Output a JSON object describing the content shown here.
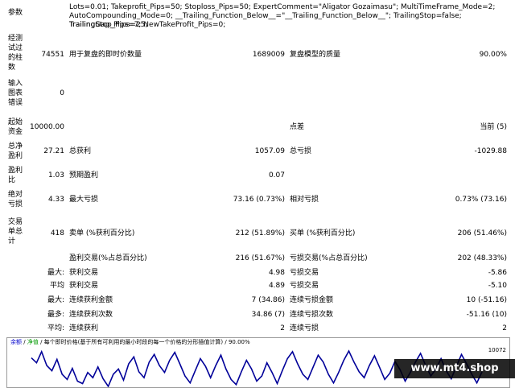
{
  "params": {
    "label": "参数",
    "lines": [
      "Lots=0.01; Takeprofit_Pips=50; Stoploss_Pips=50; ExpertComment=\"Aligator Gozaimasu\"; MultiTimeFrame_Mode=2;",
      "AutoCompounding_Mode=0; __Trailing_Function_Below__=\"__Trailing_Function_Below__\"; TrailingStop=false; TrailingStop_Pips=25;",
      "TrailingGap_Pips=7; NewTakeProfit_Pips=0;"
    ]
  },
  "rows": {
    "bars": {
      "label_lines": [
        "经测",
        "试过",
        "的柱",
        "数"
      ],
      "value": "74551",
      "mid_label": "用于复盘的即时价数量",
      "mid_value": "1689009",
      "right_label": "复盘模型的质量",
      "right_value": "90.00%"
    },
    "errors": {
      "label_lines": [
        "输入",
        "图表",
        "错误"
      ],
      "value": "0"
    },
    "deposit": {
      "label_lines": [
        "起始",
        "资金"
      ],
      "value": "10000.00",
      "right_label": "点差",
      "right_value": "当前 (5)"
    },
    "net": {
      "label_lines": [
        "总净",
        "盈利"
      ],
      "value": "27.21",
      "mid_label": "总获利",
      "mid_value": "1057.09",
      "right_label": "总亏损",
      "right_value": "-1029.88"
    },
    "pf": {
      "label_lines": [
        "盈利",
        "比"
      ],
      "value": "1.03",
      "mid_label": "预期盈利",
      "mid_value": "0.07"
    },
    "dd": {
      "label_lines": [
        "绝对",
        "亏损"
      ],
      "value": "4.33",
      "mid_label": "最大亏损",
      "mid_value": "73.16 (0.73%)",
      "right_label": "相对亏损",
      "right_value": "0.73% (73.16)"
    },
    "trades": {
      "label_lines": [
        "交易",
        "单总",
        "计"
      ],
      "value": "418",
      "mid_label": "卖单 (%获利百分比)",
      "mid_value": "212 (51.89%)",
      "right_label": "买单 (%获利百分比)",
      "right_value": "206 (51.46%)"
    },
    "winloss": {
      "mid_label": "盈利交易(%占总百分比)",
      "mid_value": "216 (51.67%)",
      "right_label": "亏损交易(%占总百分比)",
      "right_value": "202 (48.33%)"
    },
    "largest": {
      "prefix": "最大:",
      "mid_label": "获利交易",
      "mid_value": "4.98",
      "right_label": "亏损交易",
      "right_value": "-5.86"
    },
    "average": {
      "prefix": "平均",
      "mid_label": "获利交易",
      "mid_value": "4.89",
      "right_label": "亏损交易",
      "right_value": "-5.10"
    },
    "maxcons": {
      "prefix": "最大:",
      "mid_label": "连续获利金额",
      "mid_value": "7 (34.86)",
      "right_label": "连续亏损金额",
      "right_value": "10 (-51.16)"
    },
    "maxconsnum": {
      "prefix": "最多:",
      "mid_label": "连续获利次数",
      "mid_value": "34.86 (7)",
      "right_label": "连续亏损次数",
      "right_value": "-51.16 (10)"
    },
    "avgcons": {
      "prefix": "平均:",
      "mid_label": "连续获利",
      "mid_value": "2",
      "right_label": "连续亏损",
      "right_value": "2"
    }
  },
  "chart": {
    "balance_label": "余额",
    "equity_label": "净值",
    "description": "每个即时价格(基于所有可利用的最小时段的每一个价格的分形插值计算)",
    "quality": "90.00%",
    "ymax_label": "10072",
    "balance_color": "#0000aa",
    "equity_color": "#00aa00",
    "line_color": "#000099"
  },
  "chart_data": {
    "type": "line",
    "series": [
      {
        "values": [
          10052,
          10038,
          10070,
          10030,
          10015,
          10048,
          10005,
          9990,
          10022,
          9985,
          9978,
          10010,
          9995,
          10026,
          9992,
          9970,
          10005,
          10020,
          9988,
          10035,
          10055,
          10012,
          9995,
          10040,
          10062,
          10030,
          10010,
          10045,
          10068,
          10035,
          10000,
          9980,
          10015,
          10050,
          10028,
          9995,
          10030,
          10060,
          10020,
          9990,
          9975,
          10012,
          10045,
          10020,
          9985,
          10000,
          10038,
          10010,
          9978,
          10015,
          10050,
          10070,
          10035,
          10005,
          9990,
          10025,
          10060,
          10040,
          10005,
          9980,
          10010,
          10045,
          10072,
          10040,
          10012,
          9995,
          10030,
          10058,
          10025,
          9990,
          10008,
          10042,
          10018,
          9985,
          10010,
          10040,
          10065,
          10030,
          10000,
          10020,
          10050,
          10015,
          9992,
          10028,
          10062,
          10035,
          10005,
          9980,
          10012
        ]
      }
    ],
    "ylabel": "",
    "y_tick_labels": [
      "10072"
    ]
  },
  "watermark": "www.mt4.shop"
}
